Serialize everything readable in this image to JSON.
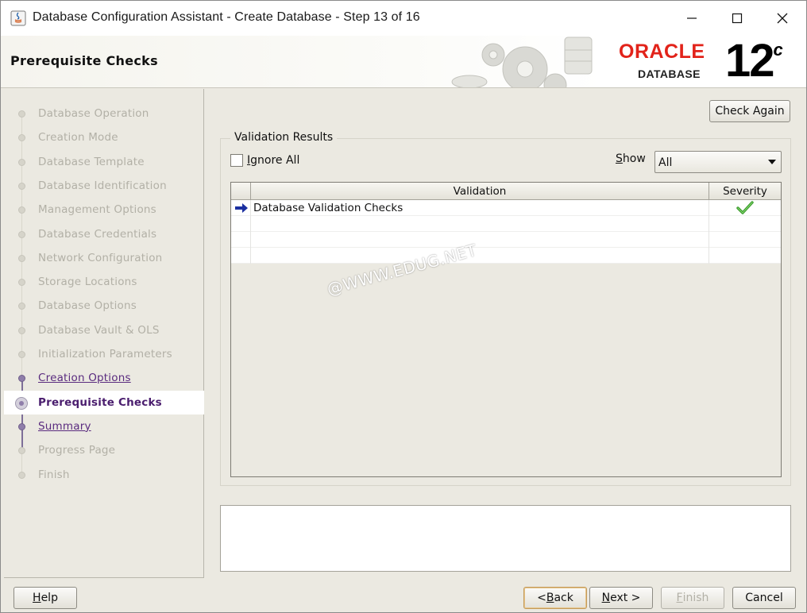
{
  "window": {
    "title": "Database Configuration Assistant - Create Database - Step 13 of 16",
    "controls": [
      "minimize",
      "maximize",
      "close"
    ]
  },
  "banner": {
    "page_title": "Prerequisite Checks",
    "brand": "ORACLE",
    "product": "DATABASE",
    "version": "12",
    "version_suffix": "c",
    "brand_color": "#e2231a"
  },
  "nav": {
    "items": [
      {
        "label": "Database Operation",
        "state": "done"
      },
      {
        "label": "Creation Mode",
        "state": "done"
      },
      {
        "label": "Database Template",
        "state": "done"
      },
      {
        "label": "Database Identification",
        "state": "done"
      },
      {
        "label": "Management Options",
        "state": "done"
      },
      {
        "label": "Database Credentials",
        "state": "done"
      },
      {
        "label": "Network Configuration",
        "state": "done"
      },
      {
        "label": "Storage Locations",
        "state": "done"
      },
      {
        "label": "Database Options",
        "state": "done"
      },
      {
        "label": "Database Vault & OLS",
        "state": "done"
      },
      {
        "label": "Initialization Parameters",
        "state": "done"
      },
      {
        "label": "Creation Options",
        "state": "visited"
      },
      {
        "label": "Prerequisite Checks",
        "state": "current"
      },
      {
        "label": "Summary",
        "state": "visited"
      },
      {
        "label": "Progress Page",
        "state": "pending"
      },
      {
        "label": "Finish",
        "state": "pending"
      }
    ]
  },
  "content": {
    "check_again_label": "Check Again",
    "group_title": "Validation Results",
    "ignore_all_label": "Ignore All",
    "ignore_all_checked": false,
    "show_label": "Show",
    "show_value": "All",
    "table": {
      "columns": [
        "Validation",
        "Severity"
      ],
      "rows": [
        {
          "validation": "Database Validation Checks",
          "severity": "check-icon",
          "selected": true
        }
      ]
    },
    "watermark": "@WWW.EDUG.NET"
  },
  "footer": {
    "help": "Help",
    "back": "< Back",
    "next": "Next >",
    "finish": "Finish",
    "cancel": "Cancel"
  }
}
